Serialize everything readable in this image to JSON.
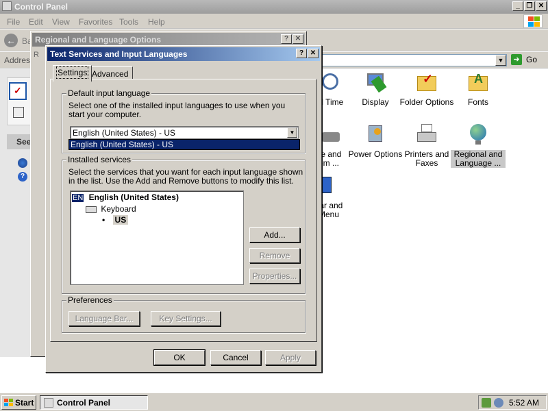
{
  "control_panel": {
    "title": "Control Panel",
    "menu": [
      "File",
      "Edit",
      "View",
      "Favorites",
      "Tools",
      "Help"
    ],
    "back_label": "Ba",
    "address_label": "Address",
    "go_label": "Go",
    "sidepane_see_label": "See",
    "icons": [
      {
        "label": "nd Time",
        "icon": "clock-icon"
      },
      {
        "label": "Display",
        "icon": "display-icon"
      },
      {
        "label": "Folder Options",
        "icon": "folder-options-icon"
      },
      {
        "label": "Fonts",
        "icon": "fonts-folder-icon"
      },
      {
        "label": "ne and\nem ...",
        "icon": "phone-modem-icon"
      },
      {
        "label": "Power Options",
        "icon": "power-options-icon"
      },
      {
        "label": "Printers and\nFaxes",
        "icon": "printer-icon"
      },
      {
        "label": "Regional and\nLanguage ...",
        "icon": "globe-icon"
      },
      {
        "label": "bar and\nMenu",
        "icon": "taskbar-icon"
      }
    ]
  },
  "regional_dialog": {
    "title": "Regional and Language Options",
    "side_label": "R"
  },
  "text_services_dialog": {
    "title": "Text Services and Input Languages",
    "help_button": "?",
    "close_button": "✕",
    "tabs": [
      "Settings",
      "Advanced"
    ],
    "default_input": {
      "group_title": "Default input language",
      "description": "Select one of the installed input languages to use when you start your computer.",
      "selected_value": "English (United States) - US",
      "dropdown_option": "English (United States) - US"
    },
    "installed_services": {
      "group_title": "Installed services",
      "description": "Select the services that you want for each input language shown in the list. Use the Add and Remove buttons to modify this list.",
      "tree": {
        "lang_code": "EN",
        "language": "English (United States)",
        "category": "Keyboard",
        "layout": "US"
      },
      "buttons": {
        "add": "Add...",
        "remove": "Remove",
        "properties": "Properties..."
      }
    },
    "preferences": {
      "group_title": "Preferences",
      "language_bar": "Language Bar...",
      "key_settings": "Key Settings..."
    },
    "footer": {
      "ok": "OK",
      "cancel": "Cancel",
      "apply": "Apply"
    }
  },
  "taskbar": {
    "start_label": "Start",
    "task_label": "Control Panel",
    "clock": "5:52 AM"
  }
}
